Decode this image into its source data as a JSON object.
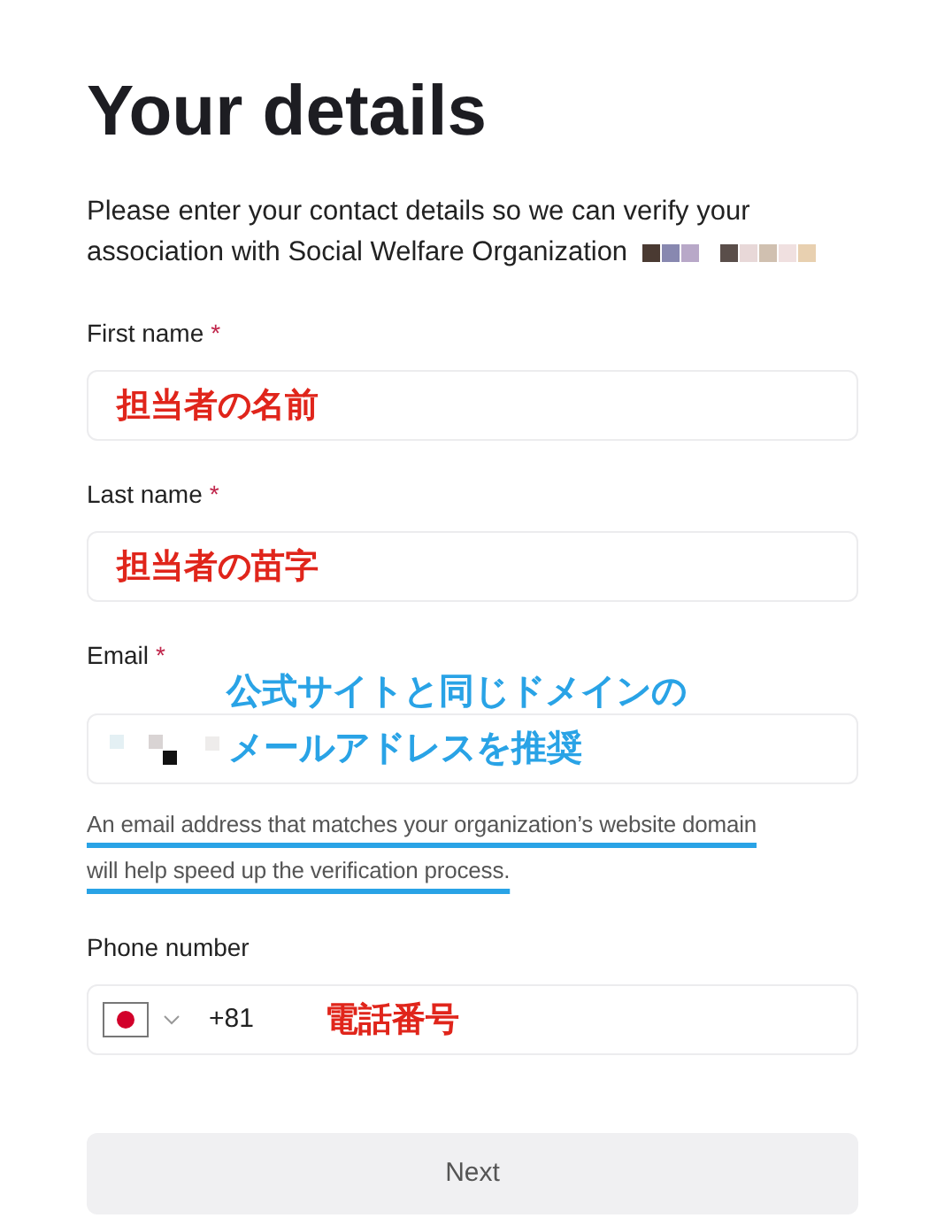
{
  "title": "Your details",
  "description": "Please enter your contact details so we can verify your association with Social Welfare Organization",
  "fields": [
    {
      "kind": "text",
      "label": "First name",
      "required_mark": "*",
      "annotation_lines": [
        "担当者の名前"
      ],
      "color": "#e0251b"
    },
    {
      "kind": "text",
      "label": "Last name",
      "required_mark": "*",
      "annotation_lines": [
        "担当者の苗字"
      ],
      "color": "#e0251b"
    },
    {
      "kind": "email",
      "label": "Email",
      "required_mark": "*",
      "annotation_lines": [
        "公式サイトと同じドメインの",
        "メールアドレスを推奨"
      ],
      "color": "#29a3e6",
      "hint": "An email address that matches your organization’s website domain will help speed up the verification process.",
      "hint_underlined": true
    },
    {
      "kind": "phone",
      "label": "Phone number",
      "dial_code": "+81",
      "annotation_lines": [
        "電話番号"
      ],
      "color": "#e0251b"
    }
  ],
  "button": "Next"
}
